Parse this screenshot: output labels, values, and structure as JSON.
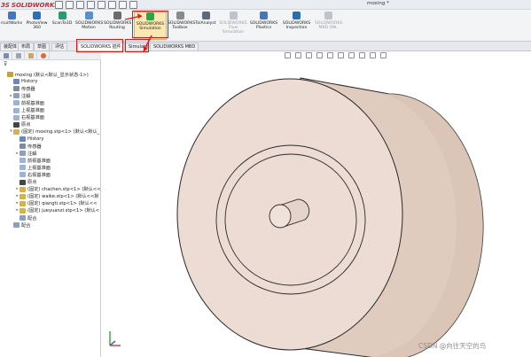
{
  "app": {
    "logo_ds": "3S",
    "logo_text": "SOLIDWORKS",
    "document_title": "moxing *"
  },
  "quick_access": [
    "new-icon",
    "open-icon",
    "save-icon",
    "print-icon",
    "undo-icon",
    "select-icon",
    "rebuild-icon",
    "options-icon"
  ],
  "ribbon": {
    "buttons": [
      {
        "id": "circuitworks",
        "label1": "rcuitWorks",
        "label2": "",
        "icon": "circuitworks-icon",
        "color": "#3a78c8",
        "enabled": true
      },
      {
        "id": "photoview",
        "label1": "PhotoView",
        "label2": "360",
        "icon": "photoview-icon",
        "color": "#2a6fbe",
        "enabled": true
      },
      {
        "id": "scanto3d",
        "label1": "ScanTo3D",
        "label2": "",
        "icon": "scanto3d-icon",
        "color": "#2c9a6a",
        "enabled": true
      },
      {
        "id": "motion",
        "label1": "SOLIDWORKS",
        "label2": "Motion",
        "icon": "motion-icon",
        "color": "#5a8fd0",
        "enabled": true
      },
      {
        "id": "routing",
        "label1": "SOLIDWORKS",
        "label2": "Routing",
        "icon": "routing-icon",
        "color": "#6a6a6a",
        "enabled": true
      },
      {
        "id": "simulation",
        "label1": "SOLIDWORKS",
        "label2": "Simulation",
        "icon": "simulation-icon",
        "color": "#2ca44a",
        "enabled": true
      },
      {
        "id": "toolbox",
        "label1": "SOLIDWORKS",
        "label2": "Toolbox",
        "icon": "toolbox-icon",
        "color": "#8a8a8a",
        "enabled": true
      },
      {
        "id": "tolanalyst",
        "label1": "TolAnalyst",
        "label2": "",
        "icon": "tolanalyst-icon",
        "color": "#5d6a7a",
        "enabled": true
      },
      {
        "id": "flow",
        "label1": "SOLIDWORKS",
        "label2": "Flow",
        "label3": "Simulation",
        "icon": "flow-icon",
        "color": "#bcc4cc",
        "enabled": false
      },
      {
        "id": "plastics",
        "label1": "SOLIDWORKS",
        "label2": "Plastics",
        "icon": "plastics-icon",
        "color": "#3f78c0",
        "enabled": true
      },
      {
        "id": "inspection",
        "label1": "SOLIDWORKS",
        "label2": "Inspection",
        "icon": "inspection-icon",
        "color": "#2b6cb0",
        "enabled": true
      },
      {
        "id": "mbd",
        "label1": "SOLIDWORKS",
        "label2": "MBD SNL",
        "icon": "mbd-icon",
        "color": "#bcc4cc",
        "enabled": false
      }
    ]
  },
  "tabs": [
    {
      "id": "assembly",
      "label": "装配体"
    },
    {
      "id": "layout",
      "label": "布局"
    },
    {
      "id": "sketch",
      "label": "草图"
    },
    {
      "id": "evaluate",
      "label": "评估"
    },
    {
      "id": "addins",
      "label": "SOLIDWORKS 插件",
      "active": true
    },
    {
      "id": "simulation",
      "label": "Simulation"
    },
    {
      "id": "mbd",
      "label": "SOLIDWORKS MBD"
    }
  ],
  "feature_tree": {
    "filter_icon": "filter-icon",
    "rows": [
      {
        "label": "moxing  (默认<默认_显示状态-1>)",
        "icon": "assembly-icon",
        "indent": 0,
        "toggle": ""
      },
      {
        "label": "History",
        "icon": "history-icon",
        "indent": 1,
        "toggle": ""
      },
      {
        "label": "传感器",
        "icon": "sensor-icon",
        "indent": 1,
        "toggle": ""
      },
      {
        "label": "注解",
        "icon": "annotation-icon",
        "indent": 1,
        "toggle": "▸"
      },
      {
        "label": "前视基准面",
        "icon": "plane-icon",
        "indent": 1,
        "toggle": ""
      },
      {
        "label": "上视基准面",
        "icon": "plane-icon",
        "indent": 1,
        "toggle": ""
      },
      {
        "label": "右视基准面",
        "icon": "plane-icon",
        "indent": 1,
        "toggle": ""
      },
      {
        "label": "原点",
        "icon": "origin-icon",
        "indent": 1,
        "toggle": ""
      },
      {
        "label": "(固定) moxing.stp<1> (默认<默认_",
        "icon": "part-icon",
        "indent": 1,
        "toggle": "▾"
      },
      {
        "label": "History",
        "icon": "history-icon",
        "indent": 2,
        "toggle": ""
      },
      {
        "label": "传感器",
        "icon": "sensor-icon",
        "indent": 2,
        "toggle": ""
      },
      {
        "label": "注解",
        "icon": "annotation-icon",
        "indent": 2,
        "toggle": "▸"
      },
      {
        "label": "前视基准面",
        "icon": "plane-icon",
        "indent": 2,
        "toggle": ""
      },
      {
        "label": "上视基准面",
        "icon": "plane-icon",
        "indent": 2,
        "toggle": ""
      },
      {
        "label": "右视基准面",
        "icon": "plane-icon",
        "indent": 2,
        "toggle": ""
      },
      {
        "label": "原点",
        "icon": "origin-icon",
        "indent": 2,
        "toggle": ""
      },
      {
        "label": "(固定) chachen.stp<1> (默认<<",
        "icon": "part-icon",
        "indent": 2,
        "toggle": "▸"
      },
      {
        "label": "(固定) waike.stp<1> (默认<<默",
        "icon": "part-icon",
        "indent": 2,
        "toggle": "▸"
      },
      {
        "label": "(固定) qiangti.stp<1> (默认<<",
        "icon": "part-icon",
        "indent": 2,
        "toggle": "▸"
      },
      {
        "label": "(固定) jueyuanzi.stp<1> (默认<",
        "icon": "part-icon",
        "indent": 2,
        "toggle": "▸"
      },
      {
        "label": "配合",
        "icon": "mate-icon",
        "indent": 2,
        "toggle": ""
      },
      {
        "label": "配合",
        "icon": "mate-icon",
        "indent": 1,
        "toggle": ""
      }
    ]
  },
  "graphics": {
    "heads_up_icons": [
      "zoom-fit-icon",
      "zoom-area-icon",
      "previous-view-icon",
      "section-view-icon",
      "view-orientation-icon",
      "display-style-icon",
      "hide-show-icon",
      "appearance-icon",
      "scene-icon",
      "view-settings-icon"
    ],
    "model_face_color": "#ecdcd3",
    "model_side_color": "#e0ccbe",
    "edge_color": "#2a2a2a"
  },
  "watermark": "CSDN @向往天空的鸟"
}
